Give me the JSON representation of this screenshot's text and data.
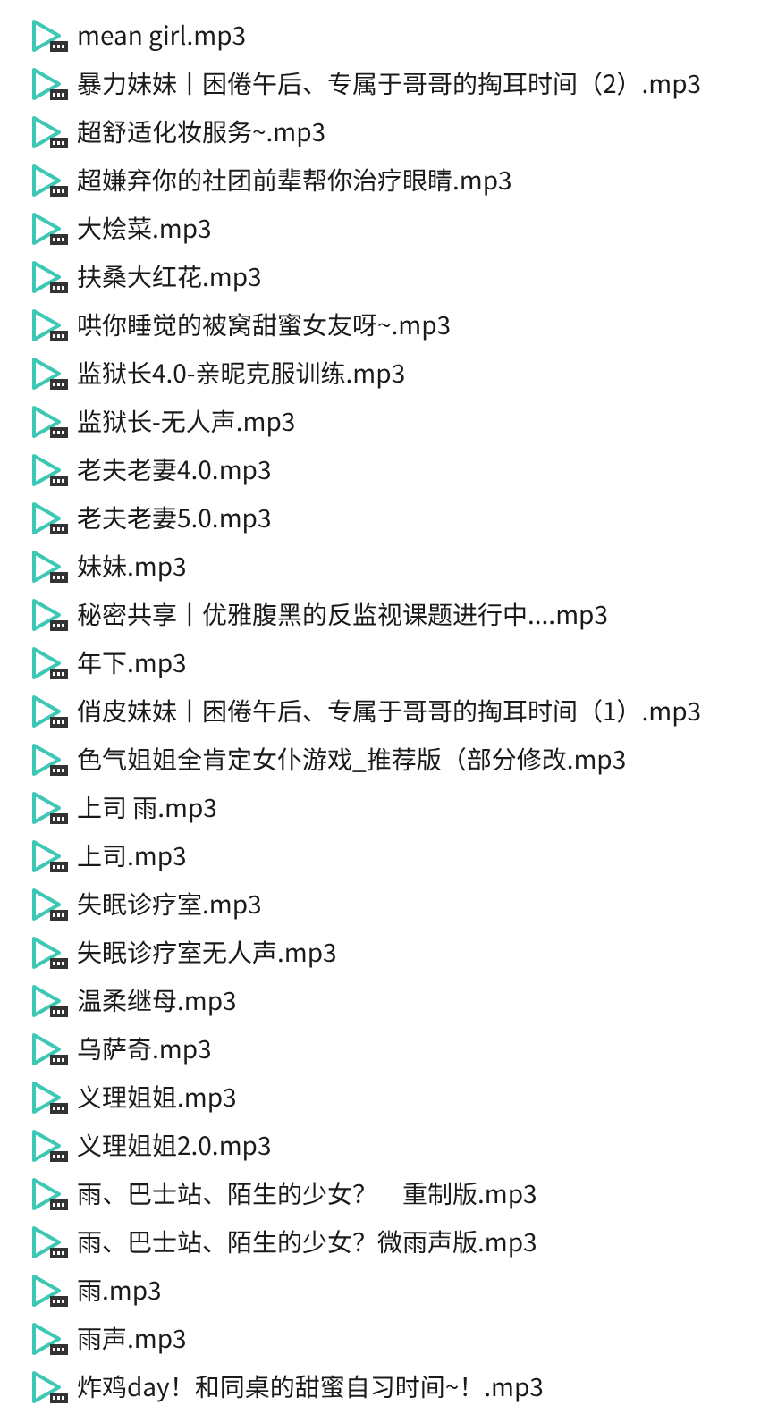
{
  "files": [
    {
      "name": "mean girl.mp3"
    },
    {
      "name": "暴力妹妹丨困倦午后、专属于哥哥的掏耳时间（2）.mp3"
    },
    {
      "name": "超舒适化妆服务~.mp3"
    },
    {
      "name": "超嫌弃你的社团前辈帮你治疗眼睛.mp3"
    },
    {
      "name": "大烩菜.mp3"
    },
    {
      "name": "扶桑大红花.mp3"
    },
    {
      "name": "哄你睡觉的被窝甜蜜女友呀~.mp3"
    },
    {
      "name": "监狱长4.0-亲昵克服训练.mp3"
    },
    {
      "name": "监狱长-无人声.mp3"
    },
    {
      "name": "老夫老妻4.0.mp3"
    },
    {
      "name": "老夫老妻5.0.mp3"
    },
    {
      "name": "妹妹.mp3"
    },
    {
      "name": "秘密共享丨优雅腹黑的反监视课题进行中....mp3"
    },
    {
      "name": "年下.mp3"
    },
    {
      "name": "俏皮妹妹丨困倦午后、专属于哥哥的掏耳时间（1）.mp3"
    },
    {
      "name": "色气姐姐全肯定女仆游戏_推荐版（部分修改.mp3"
    },
    {
      "name": "上司 雨.mp3"
    },
    {
      "name": "上司.mp3"
    },
    {
      "name": "失眠诊疗室.mp3"
    },
    {
      "name": "失眠诊疗室无人声.mp3"
    },
    {
      "name": "温柔继母.mp3"
    },
    {
      "name": "乌萨奇.mp3"
    },
    {
      "name": "义理姐姐.mp3"
    },
    {
      "name": "义理姐姐2.0.mp3"
    },
    {
      "name": "雨、巴士站、陌生的少女？　重制版.mp3"
    },
    {
      "name": "雨、巴士站、陌生的少女？微雨声版.mp3"
    },
    {
      "name": "雨.mp3"
    },
    {
      "name": "雨声.mp3"
    },
    {
      "name": "炸鸡day！和同桌的甜蜜自习时间~！.mp3"
    }
  ]
}
